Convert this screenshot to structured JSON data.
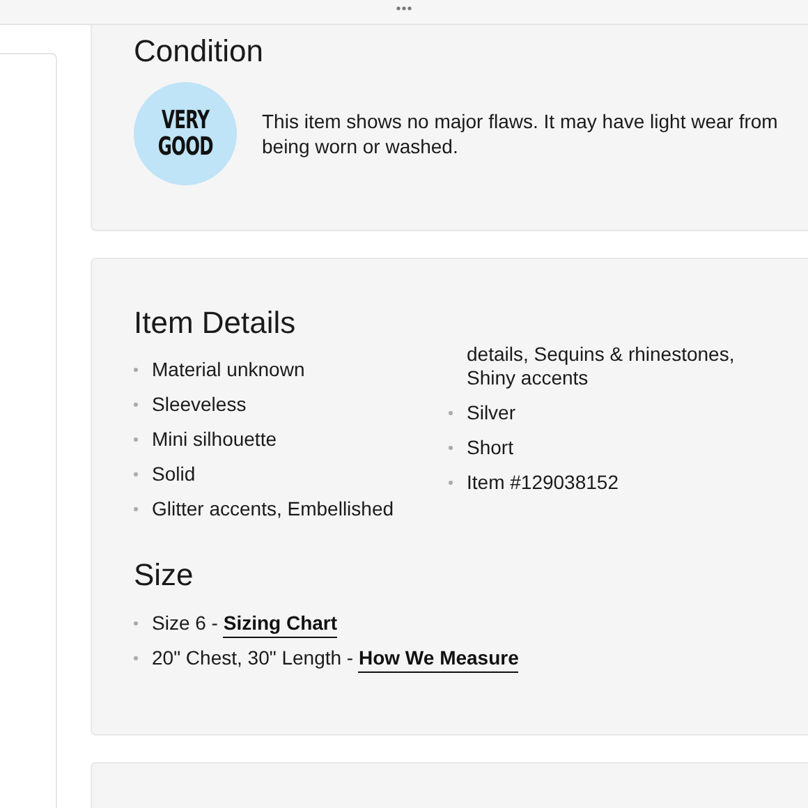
{
  "condition": {
    "title": "Condition",
    "badge": [
      "VERY",
      "GOOD"
    ],
    "description": "This item shows no major flaws. It may have light wear from being worn or washed."
  },
  "item_details": {
    "title": "Item Details",
    "columns": [
      [
        {
          "text": "Material unknown",
          "bullet": true
        },
        {
          "text": "Sleeveless",
          "bullet": true
        },
        {
          "text": "Mini silhouette",
          "bullet": true
        },
        {
          "text": "Solid",
          "bullet": true
        },
        {
          "text": "Glitter accents, Embellished",
          "bullet": true
        }
      ],
      [
        {
          "text": "details, Sequins & rhinestones, Shiny accents",
          "bullet": false
        },
        {
          "text": "Silver",
          "bullet": true
        },
        {
          "text": "Short",
          "bullet": true
        },
        {
          "text": "Item #129038152",
          "bullet": true
        }
      ]
    ]
  },
  "size": {
    "title": "Size",
    "items": [
      {
        "text": "Size 6 - ",
        "link": "Sizing Chart"
      },
      {
        "text": "20\" Chest, 30\" Length - ",
        "link": "How We Measure"
      }
    ]
  }
}
